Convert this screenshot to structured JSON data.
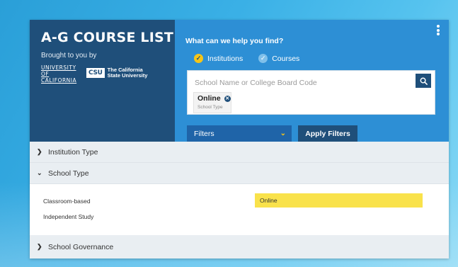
{
  "brand": {
    "title": "A-G COURSE LIST",
    "subtitle": "Brought to you by",
    "uc_logo_lines": [
      "UNIVERSITY",
      "OF",
      "CALIFORNIA"
    ],
    "csu_badge": "CSU",
    "csu_lines": [
      "The California",
      "State University"
    ],
    "color": "#1f4f7a"
  },
  "search": {
    "prompt": "What can we help you find?",
    "radios": [
      {
        "label": "Institutions",
        "selected": true
      },
      {
        "label": "Courses",
        "selected": false
      }
    ],
    "placeholder": "School Name or College Board Code",
    "search_icon": "search-icon",
    "chip": {
      "value": "Online",
      "label": "School Type"
    },
    "filters_label": "Filters",
    "apply_label": "Apply Filters",
    "panel_color": "#2d8fd5",
    "accent": "#f5c518"
  },
  "sections": [
    {
      "label": "Institution Type",
      "expanded": false
    },
    {
      "label": "School Type",
      "expanded": true
    },
    {
      "label": "School Governance",
      "expanded": false
    }
  ],
  "school_type_options": {
    "left": [
      "Classroom-based",
      "Independent Study"
    ],
    "right": [
      {
        "label": "Online",
        "selected": true,
        "highlight": "#f9e24b"
      }
    ]
  }
}
